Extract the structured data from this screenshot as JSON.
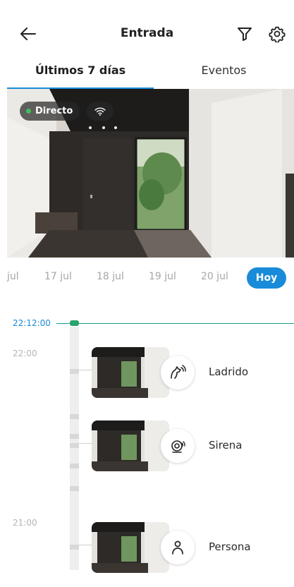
{
  "header": {
    "title": "Entrada",
    "back_icon": "arrow-left-icon",
    "filter_icon": "filter-icon",
    "settings_icon": "gear-icon"
  },
  "tabs": [
    {
      "label": "Últimos 7 días",
      "active": true
    },
    {
      "label": "Eventos",
      "active": false
    }
  ],
  "video": {
    "live_label": "Directo",
    "live_color": "#3fbf5a",
    "signal_icon": "wifi-icon"
  },
  "dates": [
    "jul",
    "17 jul",
    "18 jul",
    "19 jul",
    "20 jul"
  ],
  "today_label": "Hoy",
  "timeline": {
    "current_time": "22:12:00",
    "hours": [
      "22:00",
      "21:00"
    ],
    "events": [
      {
        "label": "Ladrido",
        "icon": "dog-bark-icon"
      },
      {
        "label": "Sirena",
        "icon": "siren-icon"
      },
      {
        "label": "Persona",
        "icon": "person-icon"
      }
    ]
  },
  "colors": {
    "accent": "#1a8bd9",
    "timeline_line": "#1aa08a",
    "now_marker": "#2aa36a"
  }
}
